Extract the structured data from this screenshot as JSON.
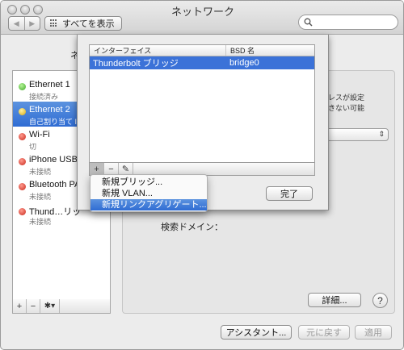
{
  "window": {
    "title": "ネットワーク"
  },
  "toolbar": {
    "back": "◀",
    "forward": "▶",
    "show_all": "すべてを表示",
    "search_placeholder": ""
  },
  "location": {
    "label": "ネ"
  },
  "services": [
    {
      "name": "Ethernet 1",
      "status": "接続済み",
      "state": "green",
      "selected": false
    },
    {
      "name": "Ethernet 2",
      "status": "自己割り当て IP",
      "state": "yellow",
      "selected": true
    },
    {
      "name": "Wi-Fi",
      "status": "切",
      "state": "red",
      "selected": false
    },
    {
      "name": "iPhone USB",
      "status": "未接続",
      "state": "red",
      "selected": false
    },
    {
      "name": "Bluetooth PA",
      "status": "未接続",
      "state": "red",
      "selected": false
    },
    {
      "name": "Thund…リッ",
      "status": "未接続",
      "state": "red",
      "selected": false
    }
  ],
  "sidebar_bar": {
    "add": "+",
    "remove": "−",
    "gear": "✱▾"
  },
  "detail": {
    "note_line1": "ドレスが設定",
    "note_line2": "できない可能",
    "search_domain_label": "検索ドメイン：",
    "advanced_button": "詳細...",
    "help": "?"
  },
  "footer": {
    "assistant": "アシスタント...",
    "revert": "元に戻す",
    "apply": "適用"
  },
  "sheet": {
    "columns": {
      "interface": "インターフェイス",
      "bsd": "BSD 名"
    },
    "rows": [
      {
        "interface": "Thunderbolt ブリッジ",
        "bsd": "bridge0"
      }
    ],
    "bar": {
      "add": "+",
      "remove": "−",
      "edit": "✎"
    },
    "done": "完了"
  },
  "menu": {
    "items": [
      "新規ブリッジ...",
      "新規 VLAN...",
      "新規リンクアグリゲート..."
    ],
    "highlighted_index": 2
  },
  "colors": {
    "selection": "#3b72d8",
    "status_green": "#3ea726",
    "status_yellow": "#d7a90f",
    "status_red": "#c9281b"
  }
}
